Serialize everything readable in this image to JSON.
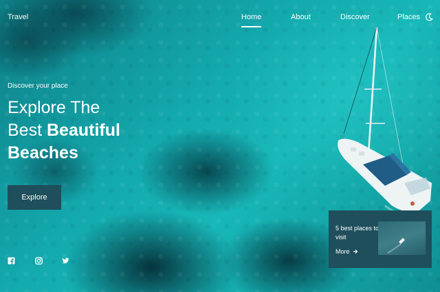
{
  "header": {
    "logo": "Travel",
    "nav": [
      "Home",
      "About",
      "Discover",
      "Places"
    ],
    "active_nav": "Home",
    "theme_icon": "moon-icon"
  },
  "hero": {
    "subtitle": "Discover your place",
    "headline": {
      "line1": "Explore The",
      "line2_light": "Best ",
      "line2_strong": "Beautiful",
      "line3": "Beaches"
    },
    "cta_label": "Explore"
  },
  "social": [
    "facebook-icon",
    "instagram-icon",
    "twitter-icon"
  ],
  "card": {
    "title": "5 best places to visit",
    "more_label": "More",
    "more_icon": "arrow-right-icon"
  },
  "colors": {
    "panel": "#1f4f5c",
    "water": "#13a9ad"
  }
}
